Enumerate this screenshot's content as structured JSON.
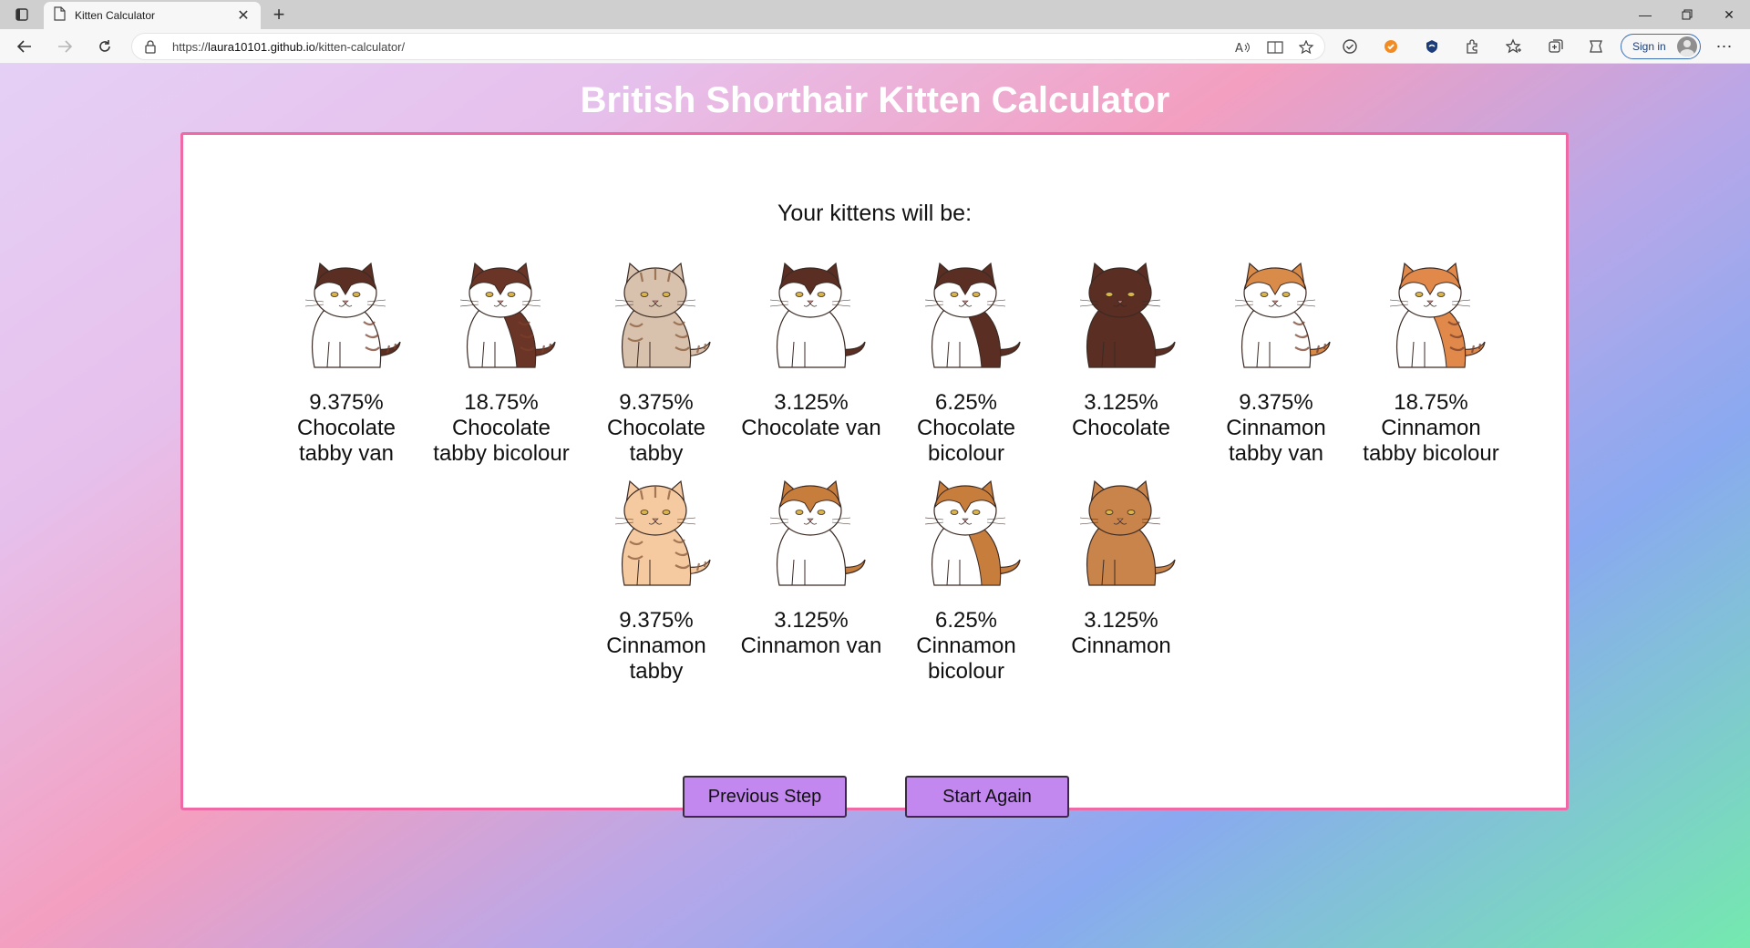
{
  "browser": {
    "tab_title": "Kitten Calculator",
    "url_prefix": "https://",
    "url_host": "laura10101.github.io",
    "url_path": "/kitten-calculator/",
    "signin_label": "Sign in"
  },
  "page": {
    "title": "British Shorthair Kitten Calculator",
    "intro": "Your kittens will be:"
  },
  "kittens": [
    {
      "percent": "9.375%",
      "name": "Chocolate tabby van",
      "icon": "chocolate-tabby-van-kitten-icon",
      "base": "#5a2e22",
      "pattern": "van",
      "tabby": true
    },
    {
      "percent": "18.75%",
      "name": "Chocolate tabby bicolour",
      "icon": "chocolate-tabby-bicolour-kitten-icon",
      "base": "#6a3526",
      "pattern": "bicolour",
      "tabby": true
    },
    {
      "percent": "9.375%",
      "name": "Chocolate tabby",
      "icon": "chocolate-tabby-kitten-icon",
      "base": "#d8c2ad",
      "pattern": "solid",
      "tabby": true
    },
    {
      "percent": "3.125%",
      "name": "Chocolate van",
      "icon": "chocolate-van-kitten-icon",
      "base": "#5a2e22",
      "pattern": "van",
      "tabby": false
    },
    {
      "percent": "6.25%",
      "name": "Chocolate bicolour",
      "icon": "chocolate-bicolour-kitten-icon",
      "base": "#5a2e22",
      "pattern": "bicolour",
      "tabby": false
    },
    {
      "percent": "3.125%",
      "name": "Chocolate",
      "icon": "chocolate-kitten-icon",
      "base": "#5a2e22",
      "pattern": "solid",
      "tabby": false
    },
    {
      "percent": "9.375%",
      "name": "Cinnamon tabby van",
      "icon": "cinnamon-tabby-van-kitten-icon",
      "base": "#d98b4a",
      "pattern": "van",
      "tabby": true
    },
    {
      "percent": "18.75%",
      "name": "Cinnamon tabby bicolour",
      "icon": "cinnamon-tabby-bicolour-kitten-icon",
      "base": "#e0894a",
      "pattern": "bicolour",
      "tabby": true
    },
    {
      "percent": "9.375%",
      "name": "Cinnamon tabby",
      "icon": "cinnamon-tabby-kitten-icon",
      "base": "#f5caa0",
      "pattern": "solid",
      "tabby": true
    },
    {
      "percent": "3.125%",
      "name": "Cinnamon van",
      "icon": "cinnamon-van-kitten-icon",
      "base": "#c77d3c",
      "pattern": "van",
      "tabby": false
    },
    {
      "percent": "6.25%",
      "name": "Cinnamon bicolour",
      "icon": "cinnamon-bicolour-kitten-icon",
      "base": "#c77d3c",
      "pattern": "bicolour",
      "tabby": false
    },
    {
      "percent": "3.125%",
      "name": "Cinnamon",
      "icon": "cinnamon-kitten-icon",
      "base": "#c8844a",
      "pattern": "solid",
      "tabby": false
    }
  ],
  "buttons": {
    "previous": "Previous Step",
    "restart": "Start Again"
  },
  "colors": {
    "card_border": "#ee6aa6",
    "button_bg": "#c388ef",
    "title_text": "#ffffff"
  }
}
